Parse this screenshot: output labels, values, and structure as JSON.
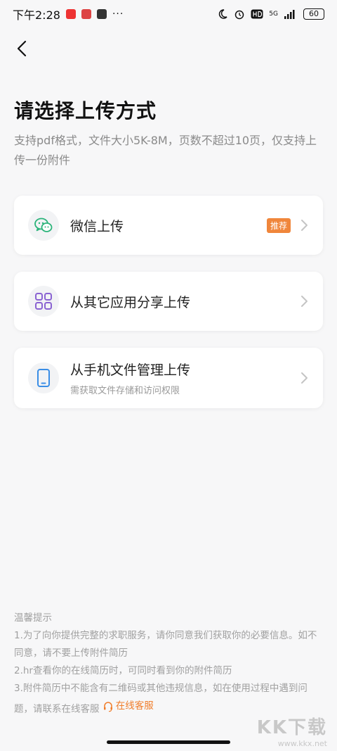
{
  "status_bar": {
    "time": "下午2:28",
    "dots": "···",
    "network": "5G",
    "battery": "60"
  },
  "header": {
    "title": "请选择上传方式",
    "description": "支持pdf格式，文件大小5K-8M，页数不超过10页，仅支持上传一份附件"
  },
  "options": [
    {
      "label": "微信上传",
      "badge": "推荐",
      "icon": "wechat-icon",
      "color": "#2bb37a"
    },
    {
      "label": "从其它应用分享上传",
      "icon": "apps-grid-icon",
      "color": "#8a63d2"
    },
    {
      "label": "从手机文件管理上传",
      "sub": "需获取文件存储和访问权限",
      "icon": "phone-icon",
      "color": "#3a8ee6"
    }
  ],
  "tips": {
    "title": "温馨提示",
    "line1": "1.为了向你提供完整的求职服务，请你同意我们获取你的必要信息。如不同意，请不要上传附件简历",
    "line2": "2.hr查看你的在线简历时，可同时看到你的附件简历",
    "line3": "3.附件简历中不能含有二维码或其他违规信息，如在使用过程中遇到问题，请联系在线客服",
    "service_link": "在线客服"
  },
  "watermark": {
    "brand": "KK下载",
    "url": "www.kkx.net"
  },
  "colors": {
    "accent": "#f07d2a",
    "background": "#f7f7f8"
  }
}
